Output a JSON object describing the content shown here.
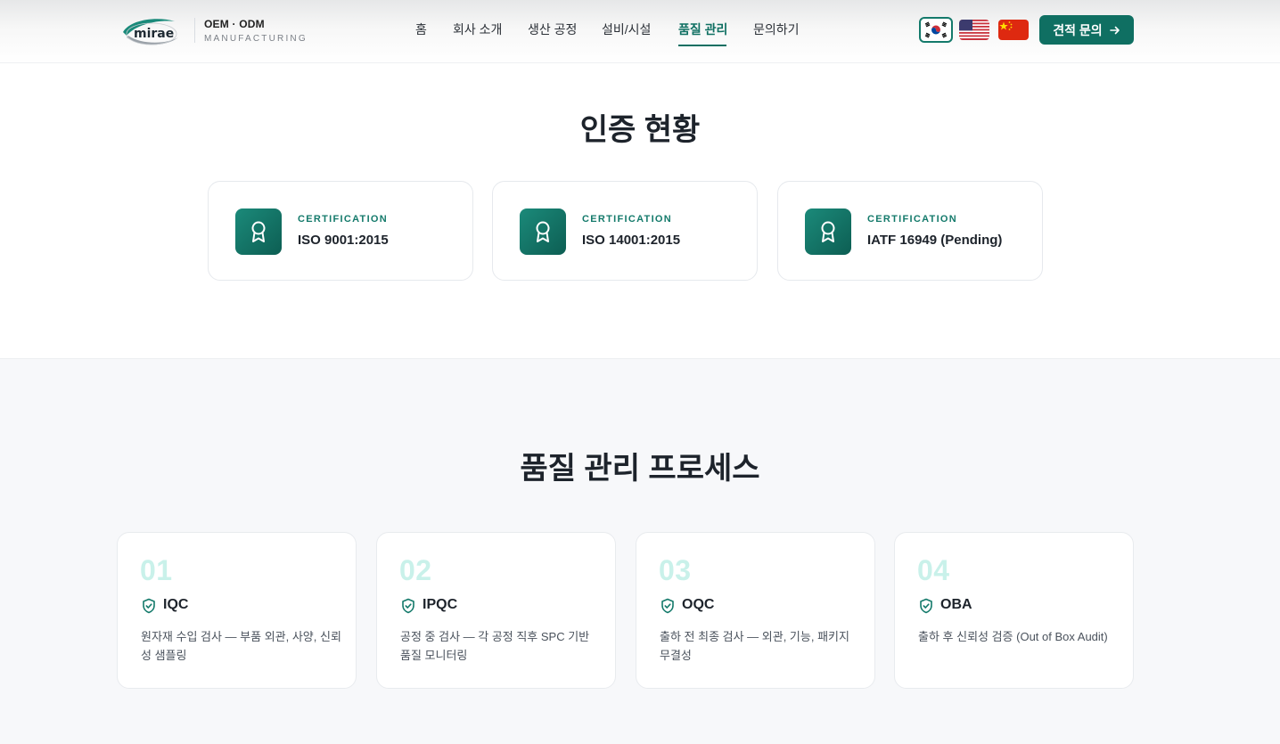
{
  "header": {
    "logo_text": "mirae",
    "brand_line1": "OEM · ODM",
    "brand_line2": "MANUFACTURING",
    "nav": [
      {
        "label": "홈"
      },
      {
        "label": "회사 소개"
      },
      {
        "label": "생산 공정"
      },
      {
        "label": "설비/시설"
      },
      {
        "label": "품질 관리",
        "active": true
      },
      {
        "label": "문의하기"
      }
    ],
    "quote_button": "견적 문의"
  },
  "certifications": {
    "title": "인증 현황",
    "items": [
      {
        "label": "CERTIFICATION",
        "name": "ISO 9001:2015"
      },
      {
        "label": "CERTIFICATION",
        "name": "ISO 14001:2015"
      },
      {
        "label": "CERTIFICATION",
        "name": "IATF 16949 (Pending)"
      }
    ]
  },
  "quality_process": {
    "title": "품질 관리 프로세스",
    "steps": [
      {
        "num": "01",
        "name": "IQC",
        "desc": "원자재 수입 검사 — 부품 외관, 사양, 신뢰성 샘플링"
      },
      {
        "num": "02",
        "name": "IPQC",
        "desc": "공정 중 검사 — 각 공정 직후 SPC 기반 품질 모니터링"
      },
      {
        "num": "03",
        "name": "OQC",
        "desc": "출하 전 최종 검사 — 외관, 기능, 패키지 무결성"
      },
      {
        "num": "04",
        "name": "OBA",
        "desc": "출하 후 신뢰성 검증 (Out of Box Audit)"
      }
    ]
  },
  "colors": {
    "primary": "#0f6f62",
    "number_tint": "#c9f1ea",
    "section_bg": "#f7f8fa"
  }
}
